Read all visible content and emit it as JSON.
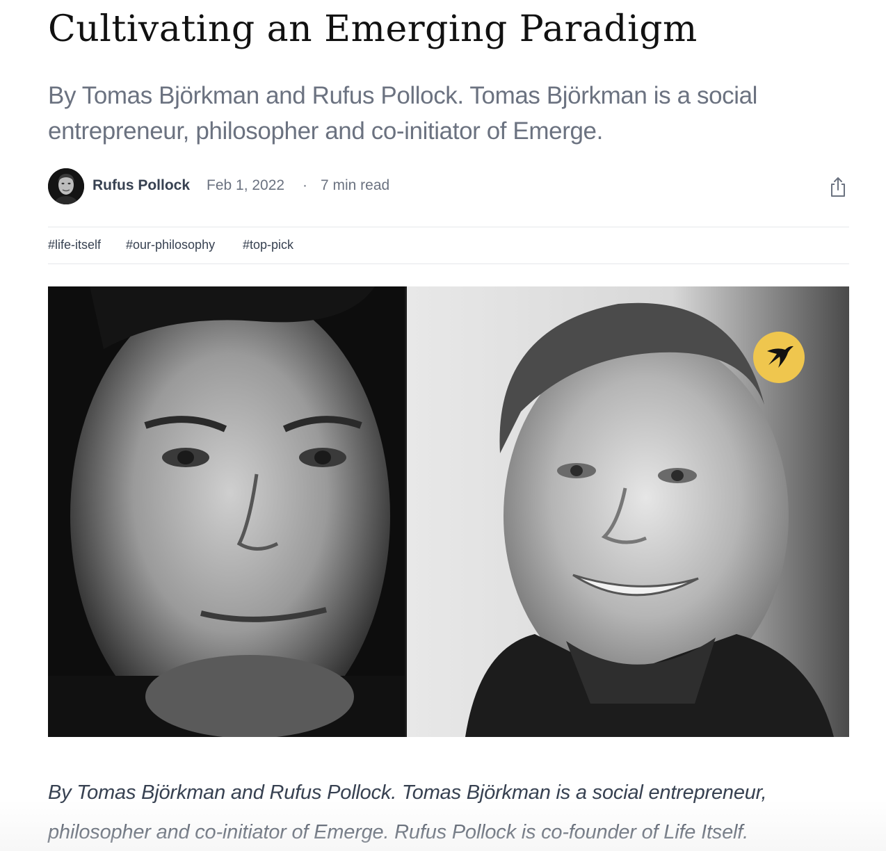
{
  "article": {
    "title": "Cultivating an Emerging Paradigm",
    "subtitle": "By Tomas Björkman and Rufus Pollock. Tomas Björkman is a social entrepreneur, philosopher and co-initiator of Emerge.",
    "lede": "By Tomas Björkman and Rufus Pollock. Tomas Björkman is a social entrepreneur, philosopher and co-initiator of Emerge. Rufus Pollock is co-founder of Life Itself."
  },
  "byline": {
    "author": "Rufus Pollock",
    "date": "Feb 1, 2022",
    "separator": "·",
    "read_time": "7 min read",
    "share_icon": "share-icon"
  },
  "tags": [
    {
      "label": "#life-itself"
    },
    {
      "label": "#our-philosophy"
    },
    {
      "label": "#top-pick"
    }
  ],
  "hero": {
    "left_portrait": "portrait-photo",
    "right_portrait": "portrait-photo",
    "badge_icon": "swallow-bird-icon",
    "badge_color": "#efc64e"
  }
}
